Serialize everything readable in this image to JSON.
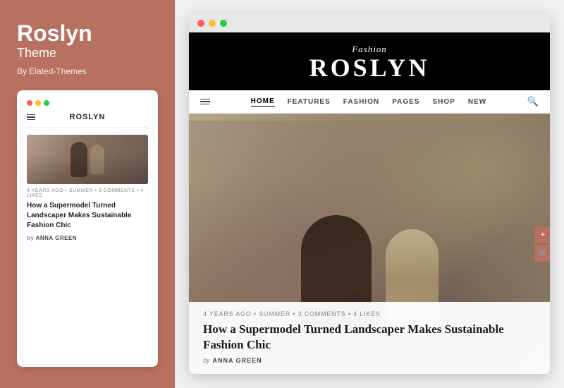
{
  "left": {
    "title": "Roslyn",
    "subtitle": "Theme",
    "by": "By Elated-Themes",
    "mobile": {
      "dots": [
        "red",
        "yellow",
        "green"
      ],
      "nav_title": "ROSLYN",
      "meta": "4 YEARS AGO  •  SUMMER  •  3 COMMENTS  •  4 LIKES",
      "headline": "How a Supermodel Turned Landscaper Makes Sustainable Fashion Chic",
      "byline_prefix": "by",
      "byline_name": "ANNA GREEN"
    }
  },
  "browser": {
    "dots": [
      "red",
      "yellow",
      "green"
    ],
    "site": {
      "logo_sub": "Fashion",
      "logo_main": "ROSLYN",
      "nav": {
        "items": [
          {
            "label": "HOME",
            "active": true
          },
          {
            "label": "FEATURES",
            "active": false
          },
          {
            "label": "FASHION",
            "active": false
          },
          {
            "label": "PAGES",
            "active": false
          },
          {
            "label": "SHOP",
            "active": false
          },
          {
            "label": "NEW",
            "active": false
          }
        ]
      },
      "article": {
        "meta": "4 YEARS AGO  •  SUMMER  •  3 COMMENTS  •  4 LIKES",
        "title": "How a Supermodel Turned Landscaper Makes Sustainable Fashion Chic",
        "byline_prefix": "by",
        "byline_name": "ANNA GREEN"
      }
    }
  }
}
